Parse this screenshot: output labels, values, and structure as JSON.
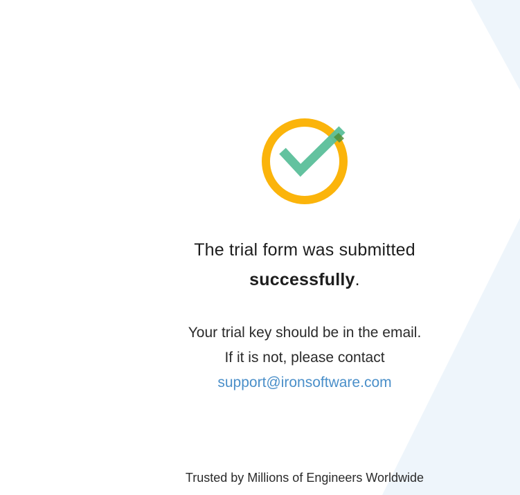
{
  "colors": {
    "ring": "#FBB40B",
    "check": "#5BBF9A",
    "check_overlap": "#4E8F3A",
    "link": "#4A8FC9",
    "bg_shape": "#EEF5FB"
  },
  "icon": "success-check-icon",
  "headline": {
    "line1": "The trial form was submitted",
    "emphasis": "successfully",
    "period": "."
  },
  "message": {
    "line1": "Your trial key should be in the email.",
    "line2": "If it is not, please contact",
    "support_email": "support@ironsoftware.com"
  },
  "footer": {
    "text": "Trusted by Millions of Engineers Worldwide"
  }
}
